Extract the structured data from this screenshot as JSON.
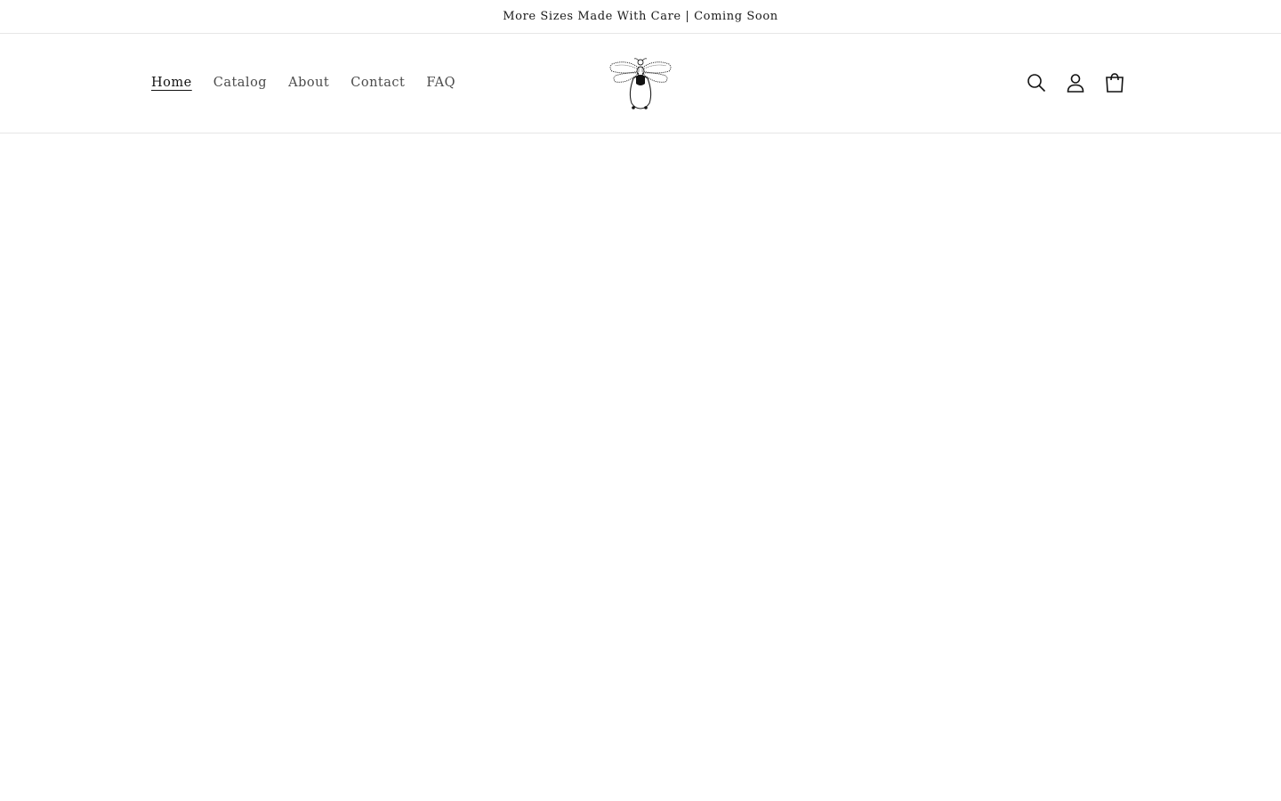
{
  "announcement": {
    "text": "More Sizes Made With Care | Coming Soon"
  },
  "nav": {
    "items": [
      {
        "label": "Home",
        "active": true
      },
      {
        "label": "Catalog",
        "active": false
      },
      {
        "label": "About",
        "active": false
      },
      {
        "label": "Contact",
        "active": false
      },
      {
        "label": "FAQ",
        "active": false
      }
    ]
  },
  "header": {
    "logo_icon": "bee-logo-icon",
    "icons": [
      "search-icon",
      "account-icon",
      "cart-icon"
    ]
  },
  "colors": {
    "text": "#121212",
    "nav_text": "#4a4a4a",
    "border": "#e6e6e6",
    "background": "#ffffff"
  }
}
